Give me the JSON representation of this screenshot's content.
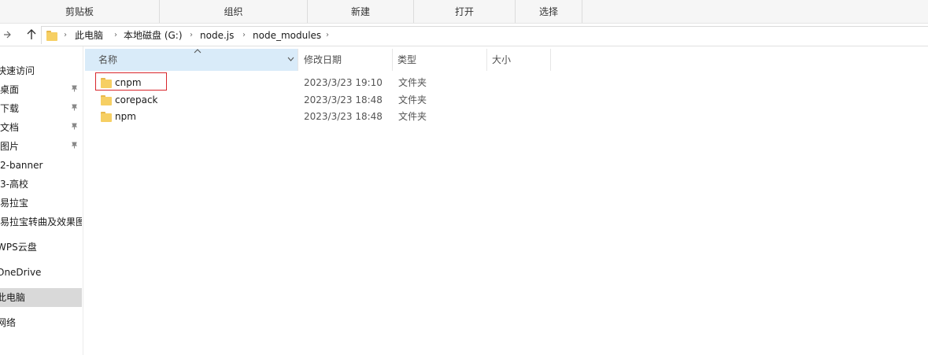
{
  "ribbon": {
    "groups": [
      "剪贴板",
      "组织",
      "新建",
      "打开",
      "选择"
    ]
  },
  "address": {
    "back_label": "←",
    "forward_label": "→",
    "up_label": "↑",
    "crumbs": [
      "此电脑",
      "本地磁盘 (G:)",
      "node.js",
      "node_modules"
    ],
    "separator": "›"
  },
  "nav": {
    "items": [
      {
        "label": "快速访问",
        "pinned": false
      },
      {
        "label": "桌面",
        "pinned": true
      },
      {
        "label": "下载",
        "pinned": true
      },
      {
        "label": "文档",
        "pinned": true
      },
      {
        "label": "图片",
        "pinned": true
      },
      {
        "label": "2-banner",
        "pinned": false
      },
      {
        "label": "3-高校",
        "pinned": false
      },
      {
        "label": "易拉宝",
        "pinned": false
      },
      {
        "label": "易拉宝转曲及效果图",
        "pinned": false
      },
      {
        "label": "WPS云盘",
        "pinned": false
      },
      {
        "label": "OneDrive",
        "pinned": false
      },
      {
        "label": "此电脑",
        "pinned": false,
        "selected": true
      },
      {
        "label": "网络",
        "pinned": false
      }
    ],
    "pin_glyph": "📌"
  },
  "columns": {
    "name": "名称",
    "modified": "修改日期",
    "type": "类型",
    "size": "大小"
  },
  "files": [
    {
      "name": "cnpm",
      "modified": "2023/3/23 19:10",
      "type": "文件夹",
      "highlighted": true
    },
    {
      "name": "corepack",
      "modified": "2023/3/23 18:48",
      "type": "文件夹"
    },
    {
      "name": "npm",
      "modified": "2023/3/23 18:48",
      "type": "文件夹"
    }
  ],
  "colors": {
    "selection_header": "#d9ebf9",
    "folder": "#f6cf63",
    "highlight_border": "#d8262c"
  }
}
